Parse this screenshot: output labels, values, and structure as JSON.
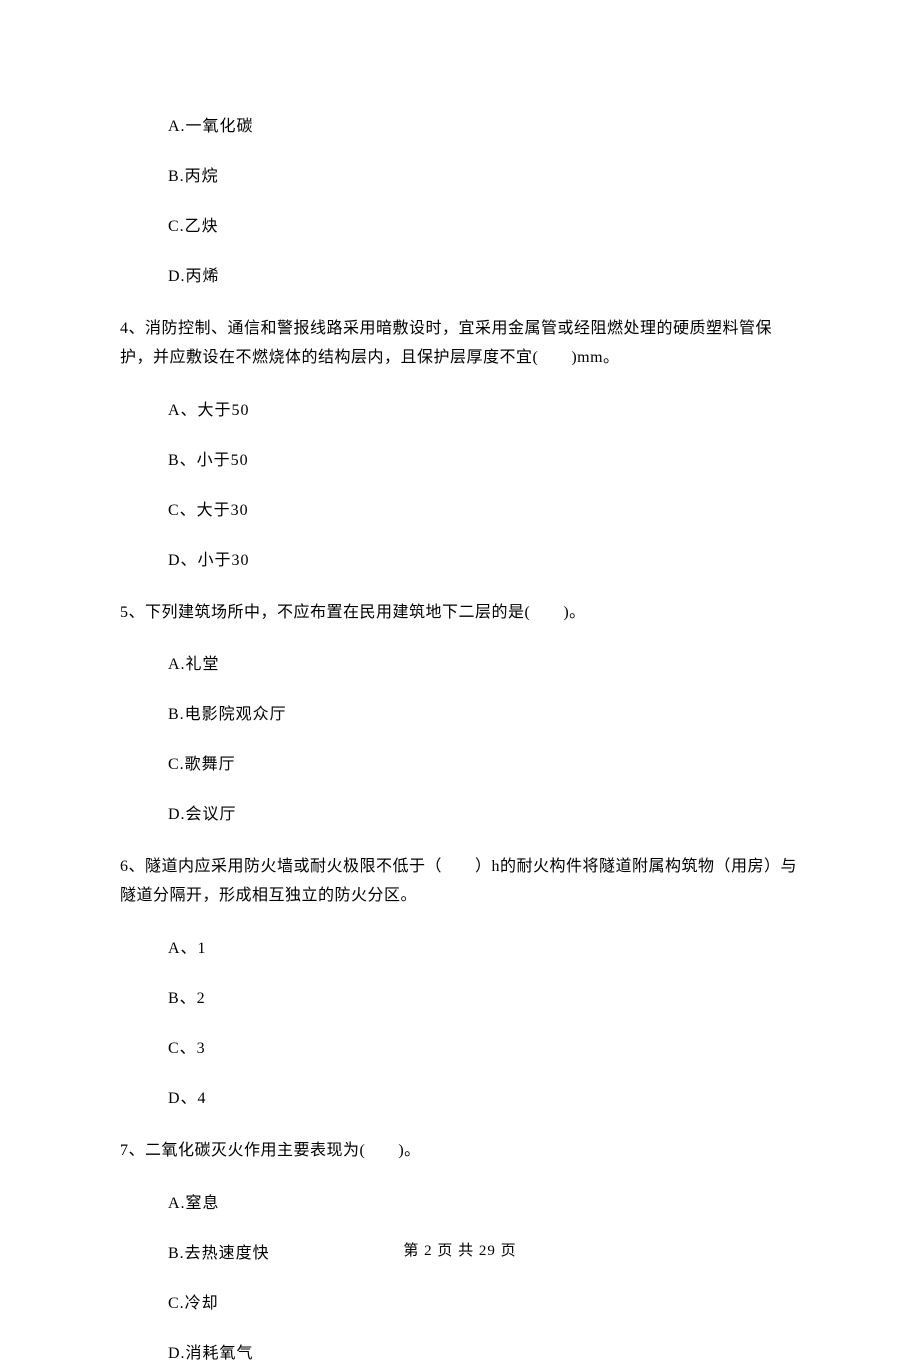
{
  "q3": {
    "options": {
      "a": "A.一氧化碳",
      "b": "B.丙烷",
      "c": "C.乙炔",
      "d": "D.丙烯"
    }
  },
  "q4": {
    "text": "4、消防控制、通信和警报线路采用暗敷设时，宜采用金属管或经阻燃处理的硬质塑料管保护，并应敷设在不燃烧体的结构层内，且保护层厚度不宜(　　)mm。",
    "options": {
      "a": "A、大于50",
      "b": "B、小于50",
      "c": "C、大于30",
      "d": "D、小于30"
    }
  },
  "q5": {
    "text": "5、下列建筑场所中，不应布置在民用建筑地下二层的是(　　)。",
    "options": {
      "a": "A.礼堂",
      "b": "B.电影院观众厅",
      "c": "C.歌舞厅",
      "d": "D.会议厅"
    }
  },
  "q6": {
    "text": "6、隧道内应采用防火墙或耐火极限不低于（　　）h的耐火构件将隧道附属构筑物（用房）与隧道分隔开，形成相互独立的防火分区。",
    "options": {
      "a": "A、1",
      "b": "B、2",
      "c": "C、3",
      "d": "D、4"
    }
  },
  "q7": {
    "text": "7、二氧化碳灭火作用主要表现为(　　)。",
    "options": {
      "a": "A.窒息",
      "b": "B.去热速度快",
      "c": "C.冷却",
      "d": "D.消耗氧气"
    }
  },
  "footer": "第 2 页 共 29 页"
}
